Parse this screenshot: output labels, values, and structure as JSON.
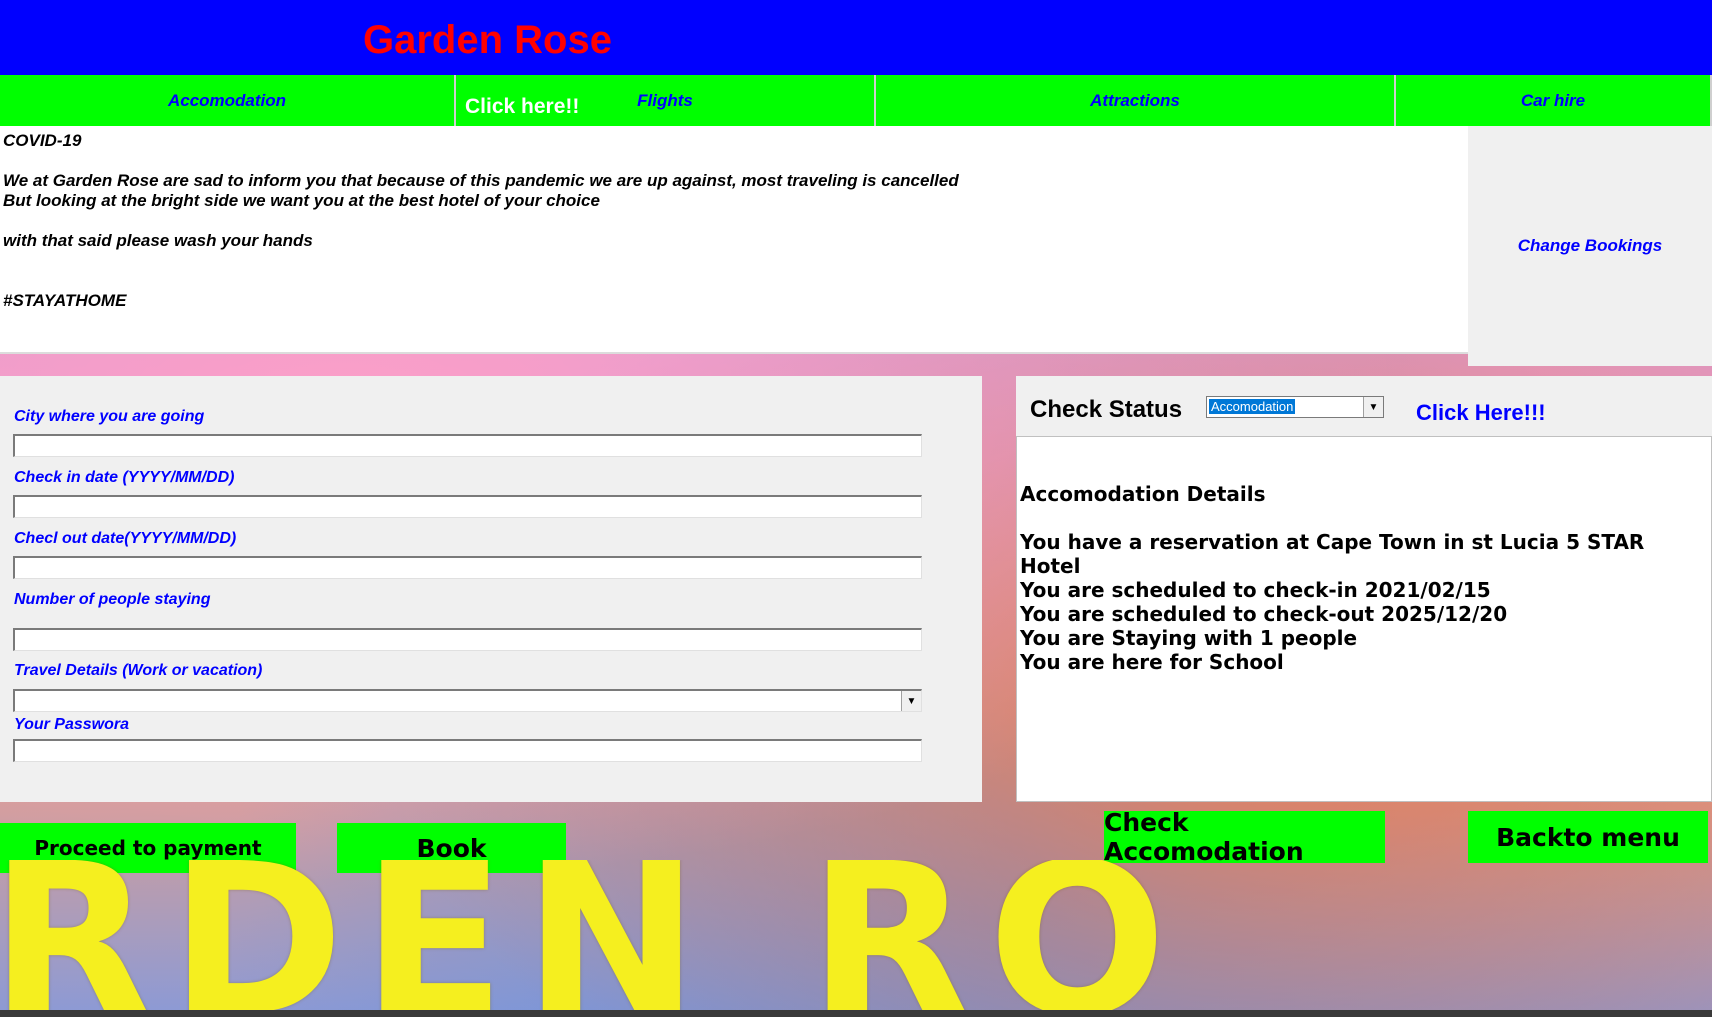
{
  "app": {
    "title": "Garden Rose"
  },
  "nav": {
    "items": [
      {
        "label": "Accomodation"
      },
      {
        "label": "Flights"
      },
      {
        "label": "Attractions"
      },
      {
        "label": "Car hire"
      }
    ],
    "overlay_label": "Click here!!"
  },
  "notice": {
    "heading": "COVID-19",
    "line1": "We at Garden Rose are sad to inform you that because of this pandemic we are up against, most traveling is cancelled",
    "line2": "But looking at the bright side we want you at the best hotel of your choice",
    "line3": "with that said please wash your hands",
    "hashtag": "#STAYATHOME"
  },
  "side": {
    "change_bookings": "Change Bookings"
  },
  "form": {
    "city_label": "City where you are going",
    "checkin_label": "Check in date (YYYY/MM/DD)",
    "checkout_label": "Checl out date(YYYY/MM/DD)",
    "people_label": "Number of people staying",
    "travel_label": "Travel Details (Work or vacation)",
    "password_label": "Your Passwora",
    "city_value": "",
    "checkin_value": "",
    "checkout_value": "",
    "people_value": "",
    "travel_value": "",
    "password_value": ""
  },
  "status": {
    "title": "Check Status",
    "selected": "Accomodation",
    "click_here": "Click Here!!!",
    "details": {
      "heading": "Accomodation Details",
      "reservation": "You have a reservation at Cape Town in st Lucia 5 STAR Hotel",
      "checkin": "You are scheduled to check-in 2021/02/15",
      "checkout": "You are scheduled to check-out 2025/12/20",
      "people": "You are Staying with 1 people",
      "reason": "You are here for School"
    }
  },
  "actions": {
    "proceed": "Proceed to payment",
    "book": "Book",
    "check_accomodation": "Check Accomodation",
    "back": "Backto menu"
  },
  "banner": {
    "text": "RDEN RO"
  },
  "colors": {
    "header_bg": "#0000ff",
    "title": "#ff0000",
    "button_bg": "#00ff00",
    "link": "#0000ff",
    "banner_text": "#f5ef1f"
  }
}
